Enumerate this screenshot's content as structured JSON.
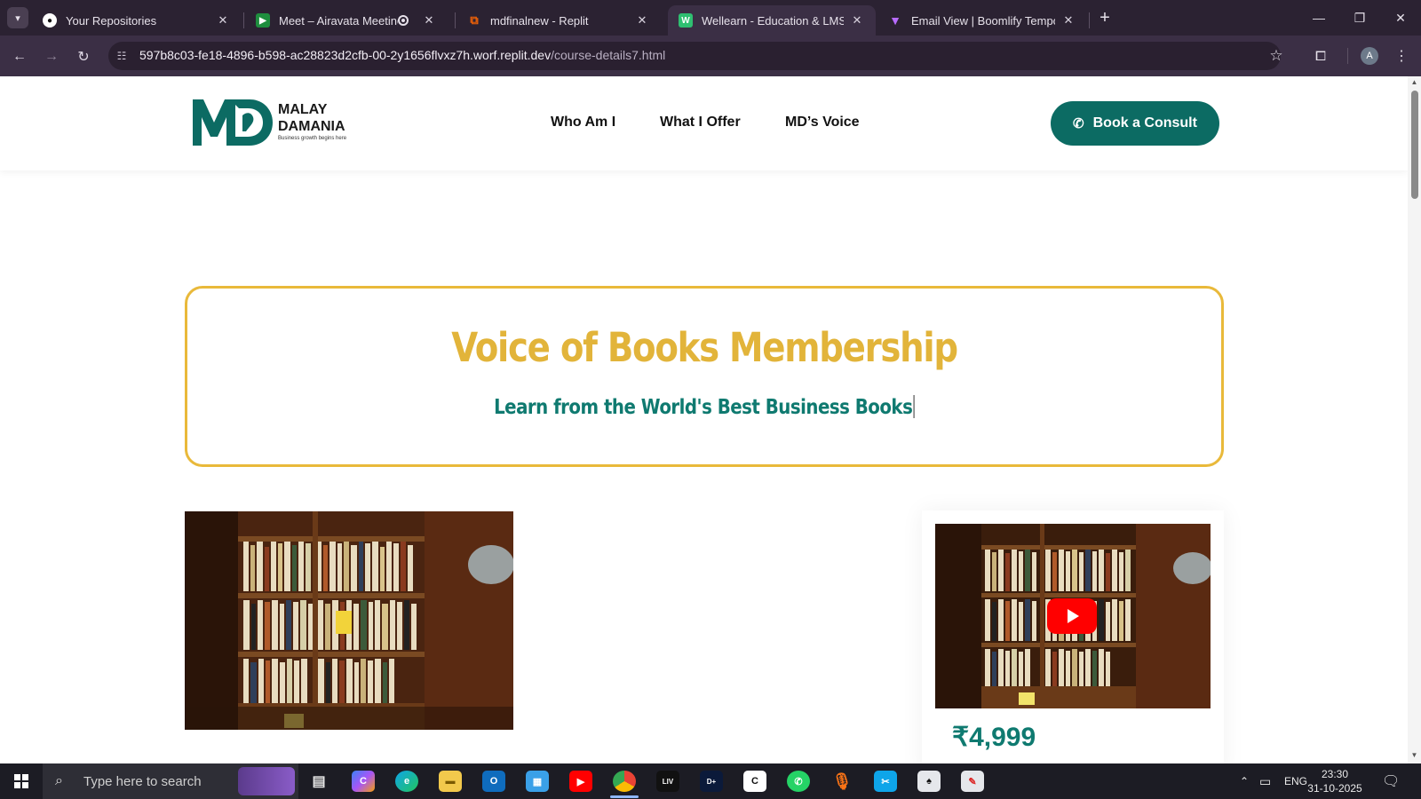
{
  "browser": {
    "tabs": [
      {
        "title": "Your Repositories",
        "icon": "github-icon",
        "active": false
      },
      {
        "title": "Meet – Airavata Meeting",
        "icon": "google-meet-icon",
        "active": false
      },
      {
        "title": "mdfinalnew - Replit",
        "icon": "replit-icon",
        "active": false
      },
      {
        "title": "Wellearn - Education & LMS HT",
        "icon": "wellearn-icon",
        "active": true
      },
      {
        "title": "Email View | Boomlify Temporar",
        "icon": "boomlify-icon",
        "active": false
      }
    ],
    "url_host": "597b8c03-fe18-4896-b598-ac28823d2cfb-00-2y1656flvxz7h.worf.replit.dev",
    "url_path": "/course-details7.html",
    "profile_initial": "A"
  },
  "site": {
    "logo": {
      "line1": "MALAY",
      "line2": "DAMANIA",
      "tagline": "Business growth begins here"
    },
    "nav": [
      "Who Am I",
      "What I Offer",
      "MD’s Voice"
    ],
    "cta_label": "Book a Consult"
  },
  "hero": {
    "title": "Voice of Books Membership",
    "subtitle": "Learn from the World's Best Business Books"
  },
  "sidebar": {
    "price": "₹4,999",
    "video_icon": "youtube-play-icon"
  },
  "taskbar": {
    "search_placeholder": "Type here to search",
    "language": "ENG",
    "time": "23:30",
    "date": "31-10-2025"
  },
  "colors": {
    "brand_teal": "#0c6b63",
    "accent_gold": "#e2b43a",
    "subtitle_teal": "#0f7a70"
  }
}
